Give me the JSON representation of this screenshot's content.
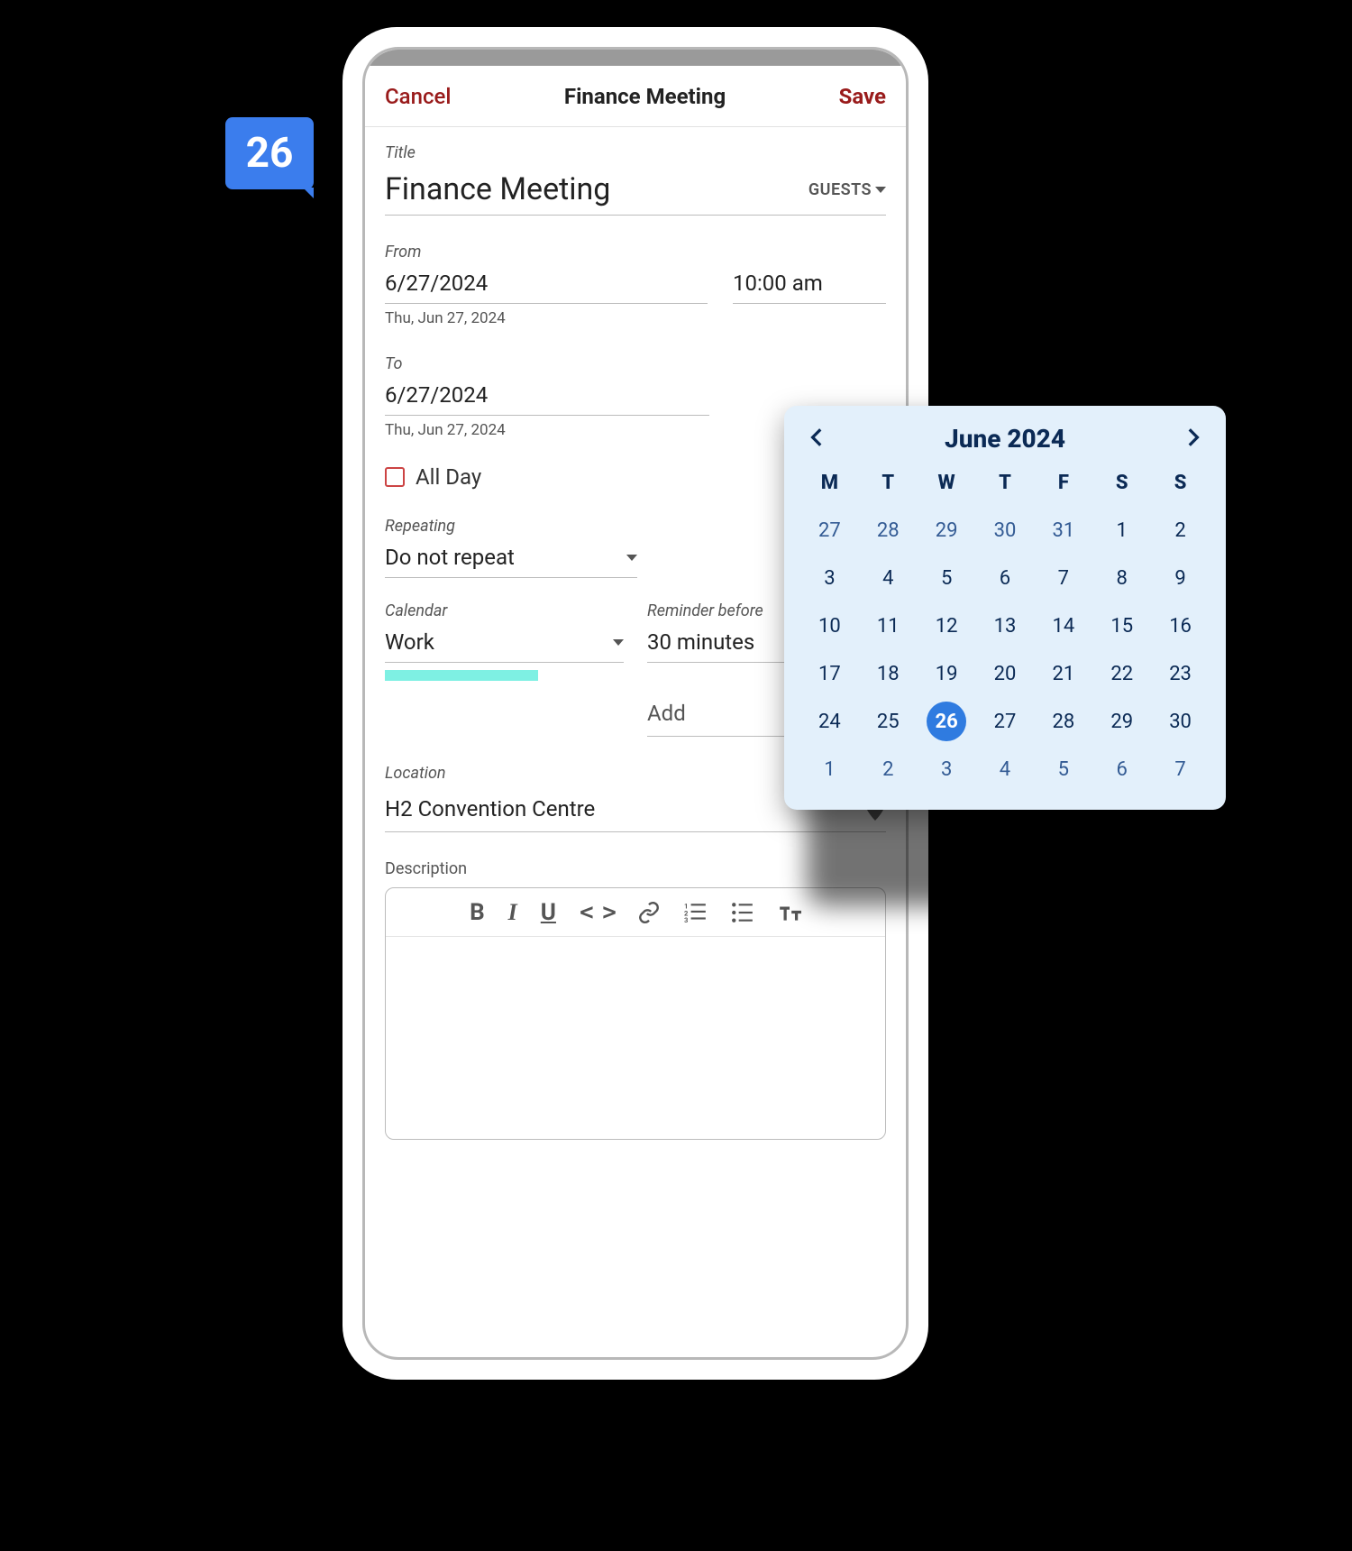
{
  "badge": {
    "number": "26"
  },
  "appbar": {
    "cancel": "Cancel",
    "title": "Finance Meeting",
    "save": "Save"
  },
  "form": {
    "title_label": "Title",
    "title_value": "Finance Meeting",
    "guests_label": "GUESTS",
    "from_label": "From",
    "from_date": "6/27/2024",
    "from_time": "10:00 am",
    "from_sub": "Thu, Jun 27, 2024",
    "to_label": "To",
    "to_date": "6/27/2024",
    "to_sub": "Thu, Jun 27, 2024",
    "all_day_label": "All Day",
    "repeating_label": "Repeating",
    "repeating_value": "Do not repeat",
    "calendar_label": "Calendar",
    "calendar_value": "Work",
    "reminder_label": "Reminder before",
    "reminder_value": "30 minutes",
    "add_label": "Add",
    "location_label": "Location",
    "location_value": "H2 Convention Centre",
    "description_label": "Description"
  },
  "toolbar": {
    "bold": "B",
    "italic": "I",
    "underline": "U",
    "code": "< >"
  },
  "datepicker": {
    "title": "June 2024",
    "dow": [
      "M",
      "T",
      "W",
      "T",
      "F",
      "S",
      "S"
    ],
    "weeks": [
      [
        {
          "n": "27",
          "other": true
        },
        {
          "n": "28",
          "other": true
        },
        {
          "n": "29",
          "other": true
        },
        {
          "n": "30",
          "other": true
        },
        {
          "n": "31",
          "other": true
        },
        {
          "n": "1"
        },
        {
          "n": "2"
        }
      ],
      [
        {
          "n": "3"
        },
        {
          "n": "4"
        },
        {
          "n": "5"
        },
        {
          "n": "6"
        },
        {
          "n": "7"
        },
        {
          "n": "8"
        },
        {
          "n": "9"
        }
      ],
      [
        {
          "n": "10"
        },
        {
          "n": "11"
        },
        {
          "n": "12"
        },
        {
          "n": "13"
        },
        {
          "n": "14"
        },
        {
          "n": "15"
        },
        {
          "n": "16"
        }
      ],
      [
        {
          "n": "17"
        },
        {
          "n": "18"
        },
        {
          "n": "19"
        },
        {
          "n": "20"
        },
        {
          "n": "21"
        },
        {
          "n": "22"
        },
        {
          "n": "23"
        }
      ],
      [
        {
          "n": "24"
        },
        {
          "n": "25"
        },
        {
          "n": "26",
          "selected": true
        },
        {
          "n": "27"
        },
        {
          "n": "28"
        },
        {
          "n": "29"
        },
        {
          "n": "30"
        }
      ],
      [
        {
          "n": "1",
          "other": true
        },
        {
          "n": "2",
          "other": true
        },
        {
          "n": "3",
          "other": true
        },
        {
          "n": "4",
          "other": true
        },
        {
          "n": "5",
          "other": true
        },
        {
          "n": "6",
          "other": true
        },
        {
          "n": "7",
          "other": true
        }
      ]
    ]
  }
}
